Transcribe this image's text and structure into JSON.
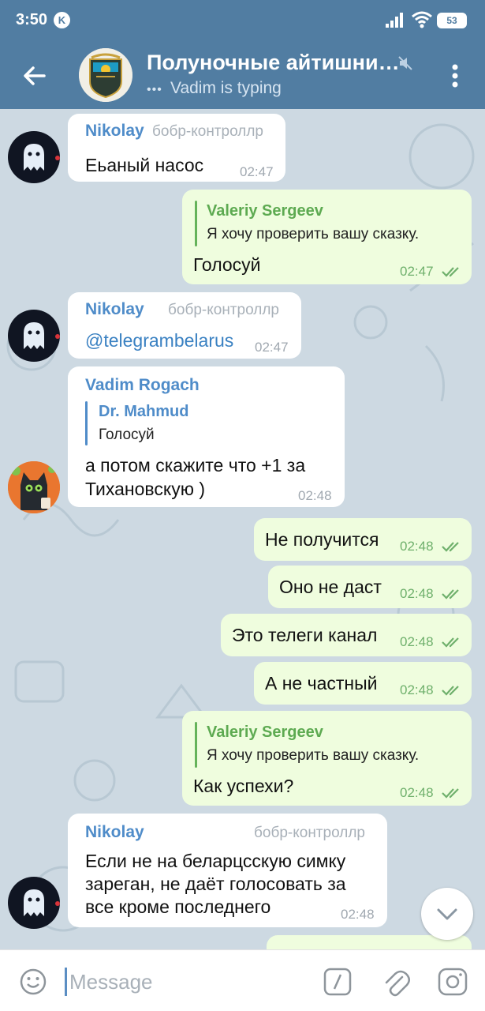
{
  "status_bar": {
    "time": "3:50",
    "k_badge": "K",
    "battery": "53"
  },
  "header": {
    "title": "Полуночные айтишни…",
    "subtitle": "Vadim is typing",
    "typing_dots": "•••",
    "avatar_caption": "ҚАЗАҚСТАН"
  },
  "messages": [
    {
      "sender": "Nikolay",
      "badge": "бобр-контроллр",
      "text": "Еьаный насос",
      "time": "02:47"
    },
    {
      "reply_to": {
        "name": "Valeriy Sergeev",
        "text": "Я хочу проверить вашу сказку."
      },
      "text": "Голосуй",
      "time": "02:47"
    },
    {
      "sender": "Nikolay",
      "badge": "бобр-контроллр",
      "text": "@telegrambelarus",
      "time": "02:47"
    },
    {
      "sender": "Vadim Rogach",
      "reply_to": {
        "name": "Dr. Mahmud",
        "text": "Голосуй"
      },
      "lines": [
        "а потом скажите что +1 за",
        "Тихановскую )"
      ],
      "time": "02:48"
    },
    {
      "text": "Не получится",
      "time": "02:48"
    },
    {
      "text": "Оно не даст",
      "time": "02:48"
    },
    {
      "text": "Это телеги канал",
      "time": "02:48"
    },
    {
      "text": "А не частный",
      "time": "02:48"
    },
    {
      "reply_to": {
        "name": "Valeriy Sergeev",
        "text": "Я хочу проверить вашу сказку."
      },
      "text": "Как успехи?",
      "time": "02:48"
    },
    {
      "sender": "Nikolay",
      "badge": "бобр-контроллр",
      "lines": [
        "Если не на беларцсскую симку",
        "зареган, не даёт голосовать за",
        "все кроме последнего"
      ],
      "time": "02:48"
    }
  ],
  "input": {
    "placeholder": "Message",
    "value": ""
  },
  "icons": {
    "back": "arrow-left-icon",
    "mute": "muted-speaker-icon",
    "menu": "more-vertical-icon",
    "read": "double-check-icon",
    "scroll_down": "chevron-down-icon",
    "emoji": "emoji-icon",
    "commands": "slash-command-icon",
    "attach": "paperclip-icon",
    "camera": "camera-icon"
  },
  "colors": {
    "header": "#517da2",
    "outgoing_bubble": "#effdde",
    "incoming_bubble": "#ffffff",
    "chat_background": "#cdd9e2",
    "sender_name": "#4f8cc9",
    "reply_name_out": "#5daa51"
  }
}
